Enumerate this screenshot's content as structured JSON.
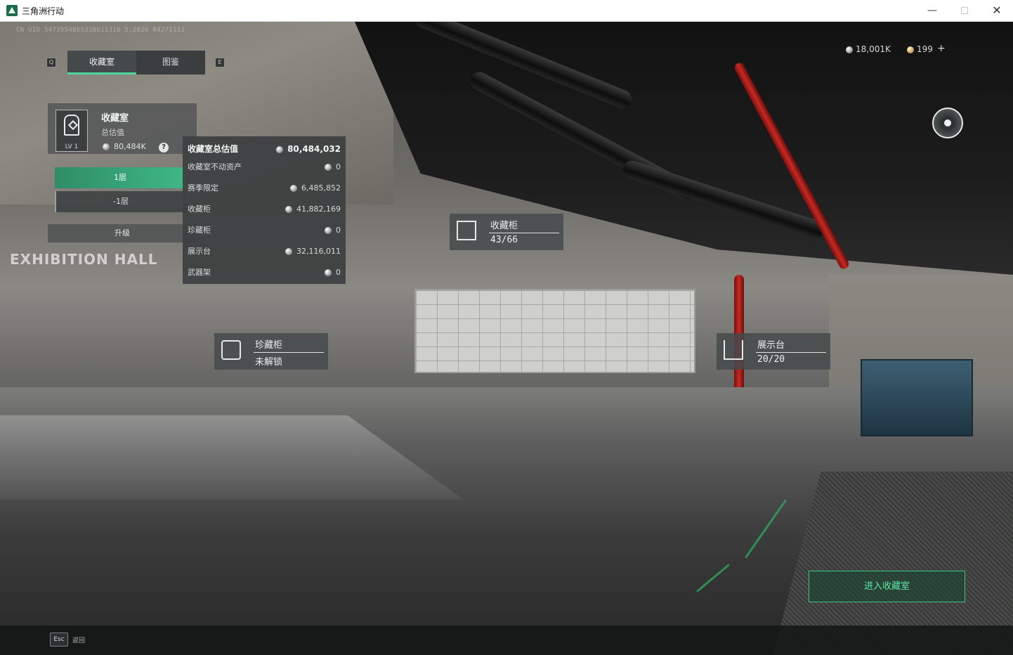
{
  "window": {
    "title": "三角洲行动",
    "minimize": "—",
    "close": "✕"
  },
  "hud": {
    "uid": "CN UID 5473554865338611316 5,2026 04272131",
    "tabs": [
      "收藏室",
      "图鉴"
    ],
    "tab_key_left": "Q",
    "tab_key_right": "E",
    "currency_silver": "18,001K",
    "currency_gold": "199",
    "currency_add": "+"
  },
  "scene": {
    "wall_text": "EXHIBITION HALL"
  },
  "vault_card": {
    "title": "收藏室",
    "subtitle": "总估值",
    "value": "80,484K",
    "level": "LV 1",
    "help": "?"
  },
  "floors": {
    "floor_1": "1层",
    "floor_b1": "-1层",
    "upgrade": "升级"
  },
  "value_panel": {
    "rows": [
      {
        "label": "收藏室总估值",
        "value": "80,484,032"
      },
      {
        "label": "收藏室不动资产",
        "value": "0"
      },
      {
        "label": "赛季限定",
        "value": "6,485,852"
      },
      {
        "label": "收藏柜",
        "value": "41,882,169"
      },
      {
        "label": "珍藏柜",
        "value": "0"
      },
      {
        "label": "展示台",
        "value": "32,116,011"
      },
      {
        "label": "武器架",
        "value": "0"
      }
    ]
  },
  "tags": {
    "collection_cabinet": {
      "label": "收藏柜",
      "value": "43/66"
    },
    "treasure_cabinet": {
      "label": "珍藏柜",
      "value": "未解锁"
    },
    "display_stand": {
      "label": "展示台",
      "value": "20/20"
    }
  },
  "actions": {
    "enter": "进入收藏室",
    "esc_key": "Esc",
    "esc_label": "返回"
  },
  "colors": {
    "accent_green": "#3fb785",
    "enter_text": "#5fe8a6"
  }
}
